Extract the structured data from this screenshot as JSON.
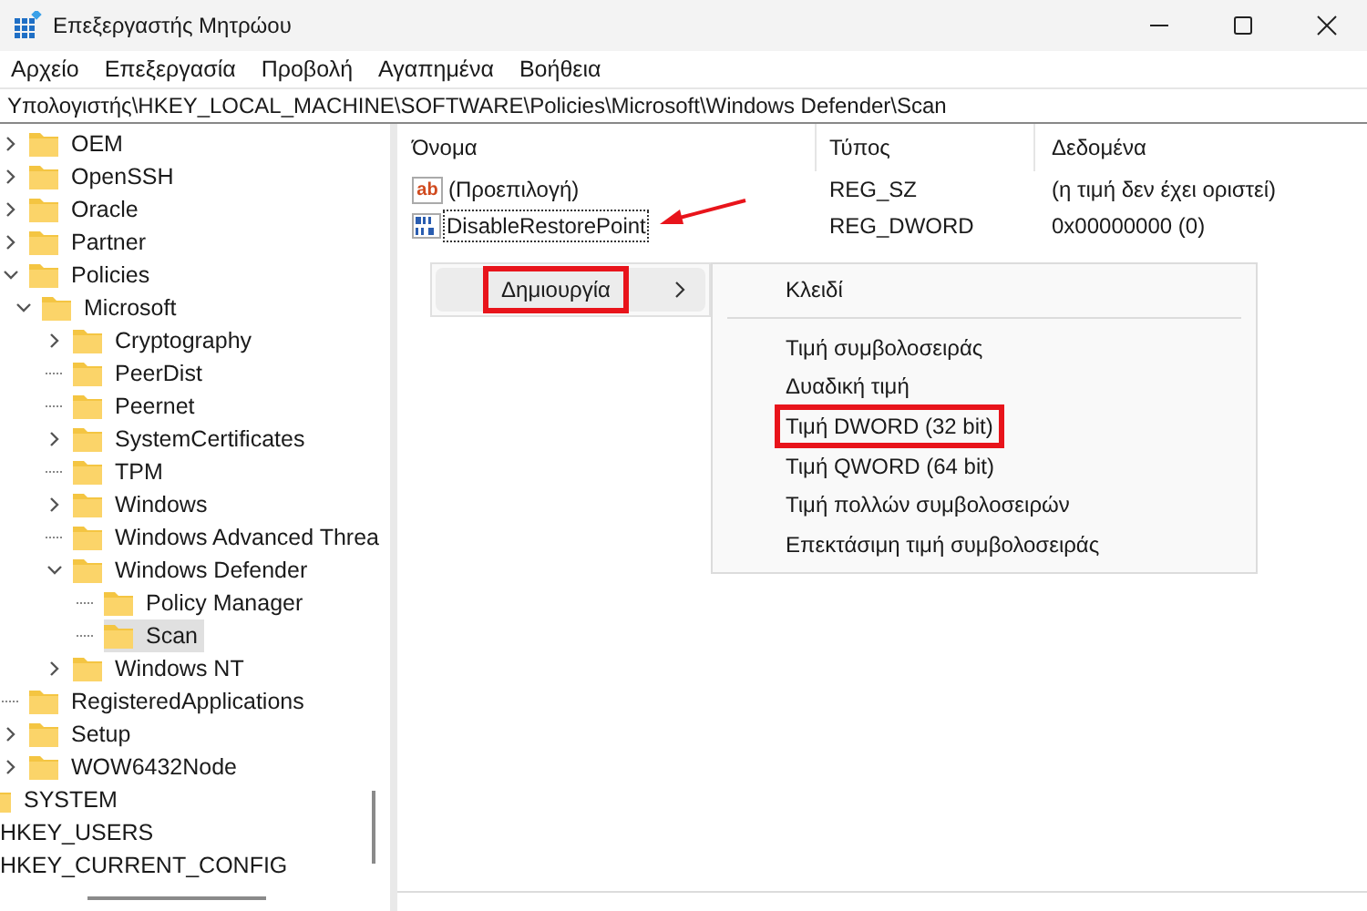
{
  "window": {
    "title": "Επεξεργαστής Μητρώου"
  },
  "menu": [
    "Αρχείο",
    "Επεξεργασία",
    "Προβολή",
    "Αγαπημένα",
    "Βοήθεια"
  ],
  "address": "Υπολογιστής\\HKEY_LOCAL_MACHINE\\SOFTWARE\\Policies\\Microsoft\\Windows Defender\\Scan",
  "tree": [
    {
      "label": "OEM",
      "kind": "branch",
      "expanded": false,
      "selected": false
    },
    {
      "label": "OpenSSH",
      "kind": "branch",
      "expanded": false,
      "selected": false
    },
    {
      "label": "Oracle",
      "kind": "branch",
      "expanded": false,
      "selected": false
    },
    {
      "label": "Partner",
      "kind": "branch",
      "expanded": false,
      "selected": false
    },
    {
      "label": "Policies",
      "kind": "branch",
      "expanded": true,
      "selected": false,
      "children": [
        {
          "label": "Microsoft",
          "kind": "branch",
          "expanded": true,
          "selected": false,
          "children": [
            {
              "label": "Cryptography",
              "kind": "branch",
              "expanded": false,
              "selected": false
            },
            {
              "label": "PeerDist",
              "kind": "leaf",
              "selected": false
            },
            {
              "label": "Peernet",
              "kind": "leaf",
              "selected": false
            },
            {
              "label": "SystemCertificates",
              "kind": "branch",
              "expanded": false,
              "selected": false
            },
            {
              "label": "TPM",
              "kind": "leaf",
              "selected": false
            },
            {
              "label": "Windows",
              "kind": "branch",
              "expanded": false,
              "selected": false
            },
            {
              "label": "Windows Advanced Threa",
              "kind": "leaf",
              "selected": false
            },
            {
              "label": "Windows Defender",
              "kind": "branch",
              "expanded": true,
              "selected": false,
              "children": [
                {
                  "label": "Policy Manager",
                  "kind": "leaf",
                  "selected": false
                },
                {
                  "label": "Scan",
                  "kind": "leaf",
                  "selected": true
                }
              ]
            },
            {
              "label": "Windows NT",
              "kind": "branch",
              "expanded": false,
              "selected": false
            }
          ]
        }
      ]
    },
    {
      "label": "RegisteredApplications",
      "kind": "leaf",
      "selected": false
    },
    {
      "label": "Setup",
      "kind": "branch",
      "expanded": false,
      "selected": false
    },
    {
      "label": "WOW6432Node",
      "kind": "branch",
      "expanded": false,
      "selected": false
    }
  ],
  "root_keys": [
    {
      "label": "SYSTEM",
      "kind": "folder"
    },
    {
      "label": "HKEY_USERS",
      "kind": "hive"
    },
    {
      "label": "HKEY_CURRENT_CONFIG",
      "kind": "hive"
    }
  ],
  "table": {
    "columns": [
      "Όνομα",
      "Τύπος",
      "Δεδομένα"
    ],
    "rows": [
      {
        "name": "(Προεπιλογή)",
        "kind": "string",
        "icon_text": "ab",
        "type": "REG_SZ",
        "data": "(η τιμή δεν έχει οριστεί)",
        "focused": false,
        "pointed": false
      },
      {
        "name": "DisableRestorePoint",
        "kind": "dword",
        "type": "REG_DWORD",
        "data": "0x00000000 (0)",
        "focused": true,
        "pointed": true
      }
    ]
  },
  "context_menu": {
    "items": [
      {
        "label": "Δημιουργία",
        "highlighted": true,
        "selected": true
      }
    ]
  },
  "submenu": {
    "items": [
      {
        "label": "Κλειδί",
        "highlighted": false
      },
      {
        "label": "Τιμή συμβολοσειράς",
        "highlighted": false
      },
      {
        "label": "Δυαδική τιμή",
        "highlighted": false
      },
      {
        "label": "Τιμή DWORD (32 bit)",
        "highlighted": true
      },
      {
        "label": "Τιμή QWORD (64 bit)",
        "highlighted": false
      },
      {
        "label": "Τιμή πολλών συμβολοσειρών",
        "highlighted": false
      },
      {
        "label": "Επεκτάσιμη τιμή συμβολοσειράς",
        "highlighted": false
      }
    ]
  }
}
